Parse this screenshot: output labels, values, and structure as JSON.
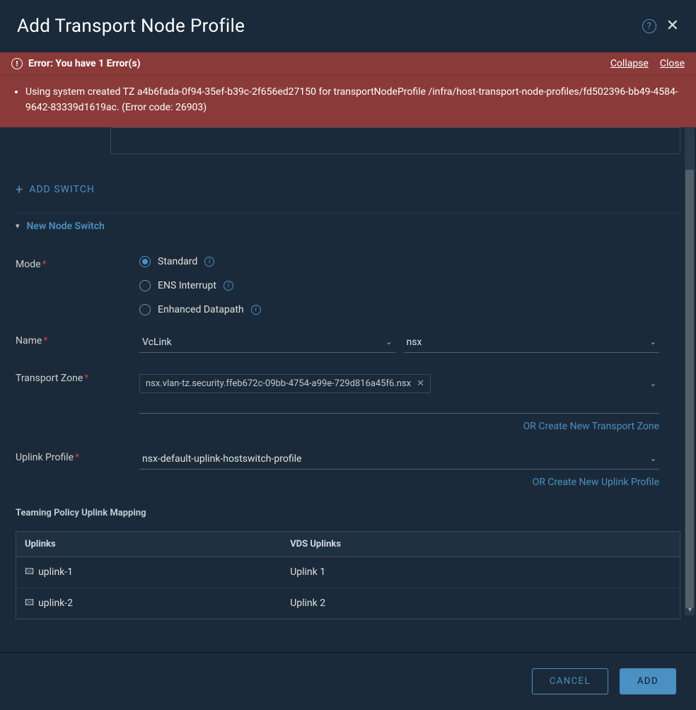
{
  "header": {
    "title": "Add Transport Node Profile"
  },
  "error": {
    "title": "Error: You have 1 Error(s)",
    "collapse": "Collapse",
    "close": "Close",
    "message": "Using system created TZ a4b6fada-0f94-35ef-b39c-2f656ed27150 for transportNodeProfile /infra/host-transport-node-profiles/fd502396-bb49-4584-9642-83339d1619ac. (Error code: 26903)"
  },
  "actions": {
    "add_switch": "ADD SWITCH",
    "cancel": "CANCEL",
    "add": "ADD"
  },
  "switch_section": {
    "title": "New Node Switch"
  },
  "labels": {
    "mode": "Mode",
    "name": "Name",
    "transport_zone": "Transport Zone",
    "uplink_profile": "Uplink Profile",
    "teaming_title": "Teaming Policy Uplink Mapping",
    "or_tz": "OR Create New Transport Zone",
    "or_uplink": "OR Create New Uplink Profile"
  },
  "mode_options": {
    "standard": "Standard",
    "ens_interrupt": "ENS Interrupt",
    "enhanced": "Enhanced Datapath"
  },
  "name_field": {
    "value1": "VcLink",
    "value2": "nsx"
  },
  "tz_chip": "nsx.vlan-tz.security.ffeb672c-09bb-4754-a99e-729d816a45f6.nsx",
  "uplink_profile_value": "nsx-default-uplink-hostswitch-profile",
  "uplink_table": {
    "col1": "Uplinks",
    "col2": "VDS Uplinks",
    "rows": [
      {
        "uplink": "uplink-1",
        "vds": "Uplink 1"
      },
      {
        "uplink": "uplink-2",
        "vds": "Uplink 2"
      }
    ]
  }
}
